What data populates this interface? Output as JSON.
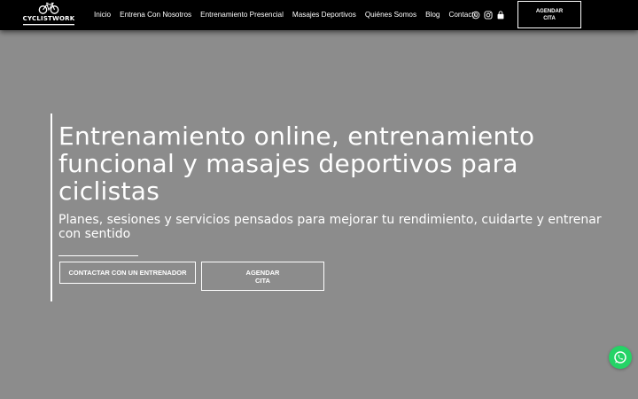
{
  "header": {
    "logo_text": "CYCLISTWORK",
    "nav": [
      "Inicio",
      "Entrena Con Nosotros",
      "Entrenamiento Presencial",
      "Masajes Deportivos",
      "Quiénes Somos",
      "Blog",
      "Contacto"
    ],
    "social_icons": [
      "whatsapp-icon",
      "instagram-icon",
      "shopping-bag-icon"
    ],
    "cta_line1": "AGENDAR",
    "cta_line2": "CITA"
  },
  "hero": {
    "title": "Entrenamiento online, entrenamiento funcional y masajes deportivos para ciclistas",
    "subtitle": "Planes, sesiones y servicios pensados para mejorar tu rendimiento, cuidarte y entrenar con sentido",
    "contact_button": "CONTACTAR CON UN ENTRENADOR",
    "cita_line1": "AGENDAR",
    "cita_line2": "CITA"
  },
  "floating": {
    "icon": "whatsapp-icon",
    "color": "#25d366"
  },
  "colors": {
    "background": "#8c8c8c",
    "header": "#000000",
    "text": "#ffffff"
  }
}
